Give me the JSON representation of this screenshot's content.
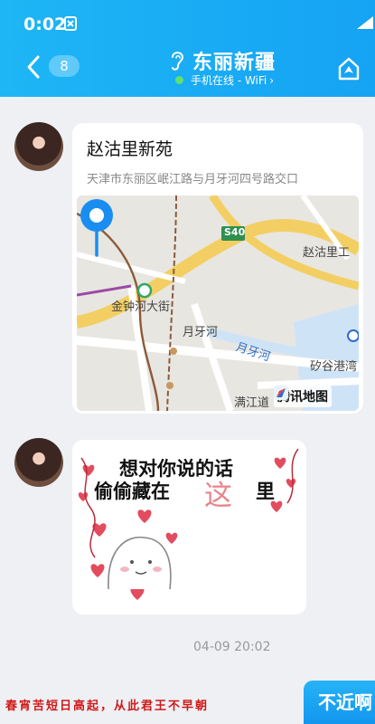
{
  "status_bar": {
    "time": "0:02"
  },
  "header": {
    "unread_count": "8",
    "contact_name": "东丽新疆",
    "presence": "手机在线 - WiFi",
    "presence_chevron": "›",
    "colors": {
      "header_bg": "#18abf4",
      "online_dot": "#5fe070"
    }
  },
  "messages": [
    {
      "type": "location",
      "place_name": "赵沽里新苑",
      "address": "天津市东丽区岷江路与月牙河四号路交口",
      "map": {
        "road_shield": "S40",
        "labels": [
          "赵沽里工",
          "金钟河大街",
          "月牙河",
          "矽谷港湾",
          "满江道"
        ],
        "river_label": "月牙河",
        "brand": "腾讯地图"
      }
    },
    {
      "type": "sticker",
      "line1": "想对你说的话",
      "line2": "偷偷藏在",
      "accent": "这",
      "tail": "里"
    }
  ],
  "timestamp": "04-09 20:02",
  "overlay": {
    "poem": "春宵苦短日高起，从此君王不早朝",
    "reply_button": "不近啊"
  }
}
